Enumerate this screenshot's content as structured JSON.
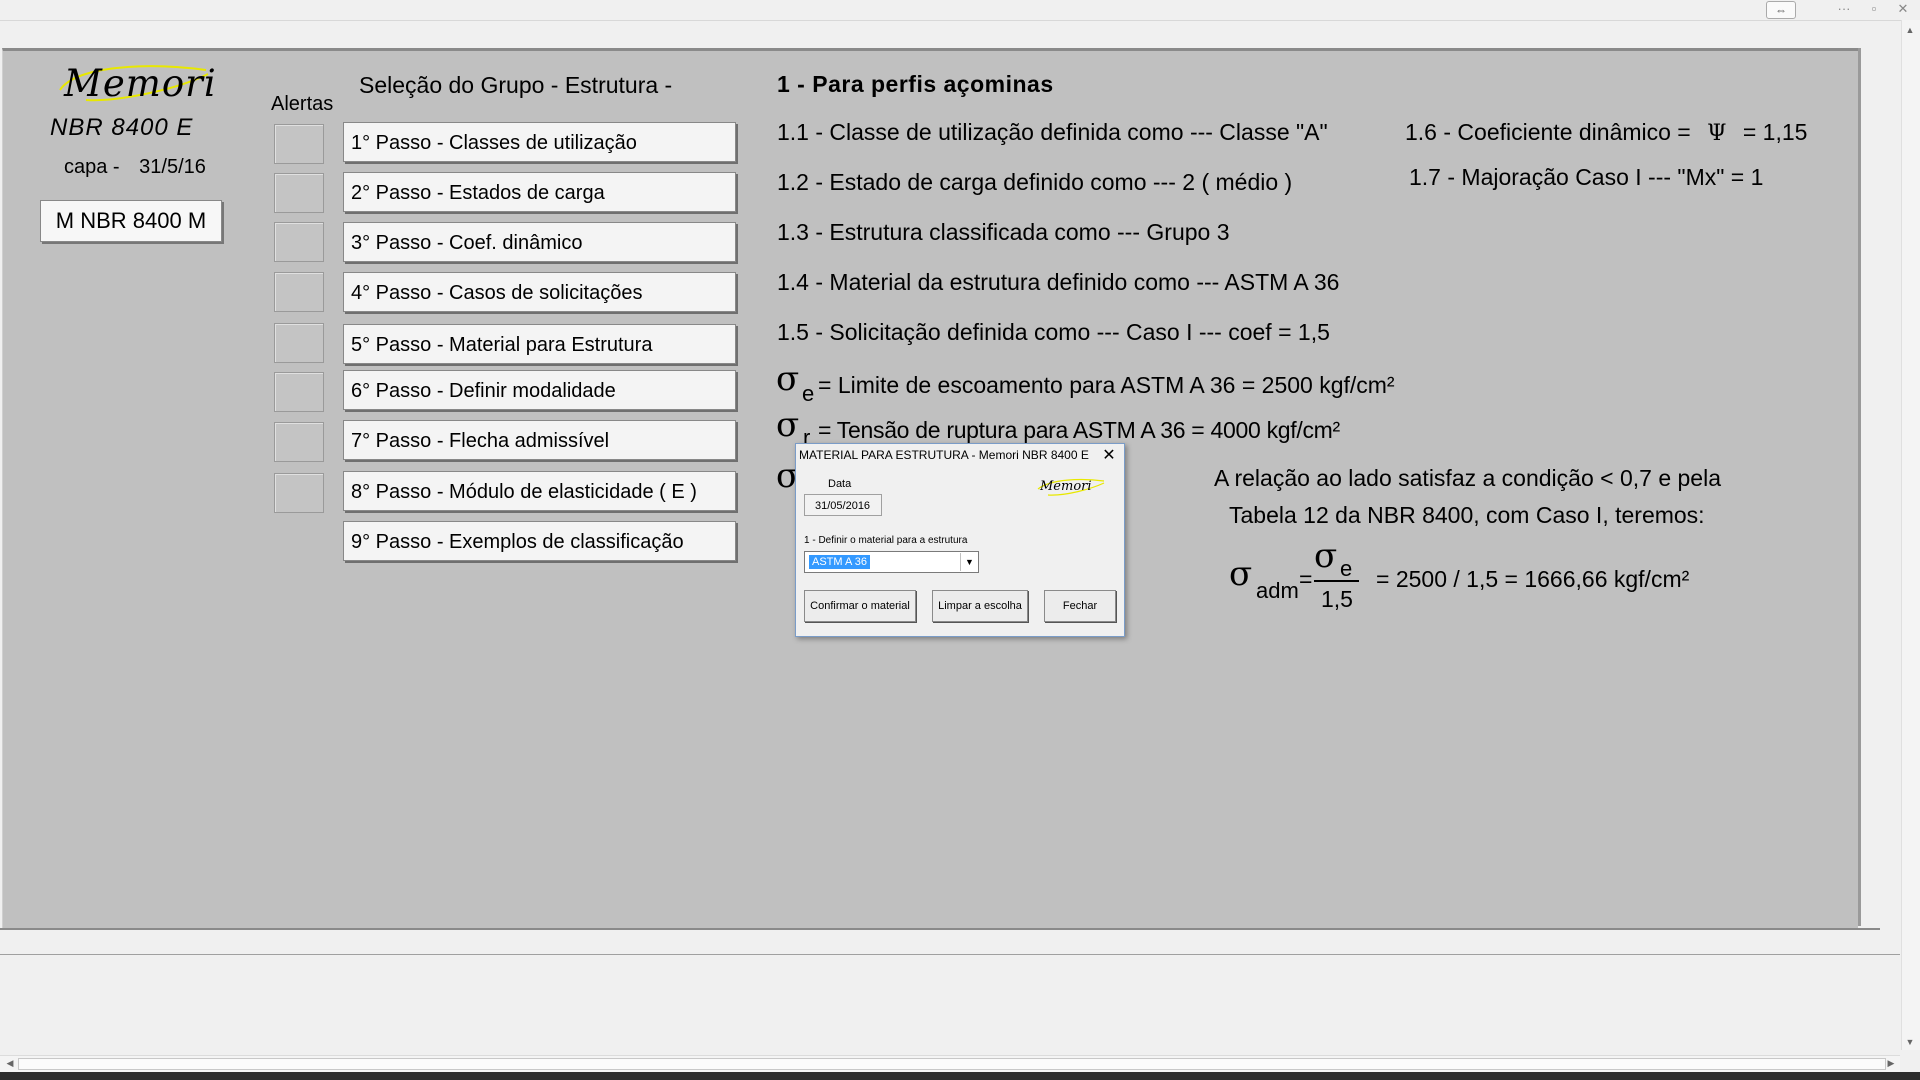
{
  "left": {
    "logo_text": "Memori",
    "norm": "NBR 8400 E",
    "capa_label": "capa -",
    "capa_date": "31/5/16",
    "m_button": "M NBR 8400 M"
  },
  "steps": {
    "title": "Seleção do Grupo - Estrutura -",
    "alerts_label": "Alertas",
    "items": [
      "1° Passo - Classes de utilização",
      "2° Passo - Estados de carga",
      "3° Passo - Coef. dinâmico",
      "4° Passo - Casos de solicitações",
      "5° Passo - Material para Estrutura",
      "6° Passo - Definir modalidade",
      "7° Passo - Flecha admissível",
      "8° Passo - Módulo de elasticidade ( E )",
      "9° Passo - Exemplos de classificação"
    ]
  },
  "info": {
    "heading": "1 - Para perfis açominas",
    "l11": "1.1 - Classe de utilização definida como --- Classe \"A\"",
    "l12": "1.2 - Estado de carga definido como --- 2 ( médio )",
    "l13": "1.3 - Estrutura classificada como --- Grupo 3",
    "l14": "1.4 - Material da estrutura definido como --- ASTM A 36",
    "l15": "1.5 - Solicitação definida como --- Caso I --- coef =  1,5",
    "l16_a": "1.6 - Coeficiente dinâmico =",
    "l16_psi": "Ψ",
    "l16_b": "= 1,15",
    "l17": "1.7 - Majoração Caso I --- \"Mx\" = 1",
    "sigma": "σ",
    "sub_e": "e",
    "sub_r": "r",
    "sub_adm": "adm",
    "se_text": "= Limite de escoamento para  ASTM A  36 = 2500 kgf/cm²",
    "sr_text": "= Tensão de ruptura para  ASTM A 36 = 4000 kgf/cm²",
    "rel_1": "A relação ao lado satisfaz a condição < 0,7 e pela",
    "rel_2": "Tabela 12 da NBR 8400, com Caso I, teremos:",
    "eq": "=",
    "frac_den": "1,5",
    "result": "= 2500 / 1,5 = 1666,66 kgf/cm²"
  },
  "dialog": {
    "title": "MATERIAL PARA ESTRUTURA - Memori NBR 8400 E",
    "close": "✕",
    "date_label": "Data",
    "date_value": "31/05/2016",
    "logo": "Memori",
    "field_label": "1 - Definir o material para a estrutura",
    "field_value": "ASTM A 36",
    "btn_confirm": "Confirmar o material",
    "btn_clear": "Limpar a escolha",
    "btn_close": "Fechar"
  },
  "chrome": {
    "resize_icon": "⇔",
    "dots": "···",
    "restore": "▫",
    "close": "✕",
    "arrow_up": "▲",
    "arrow_down": "▼",
    "arrow_left": "◀",
    "arrow_right": "▶",
    "dropdown": "▼"
  }
}
